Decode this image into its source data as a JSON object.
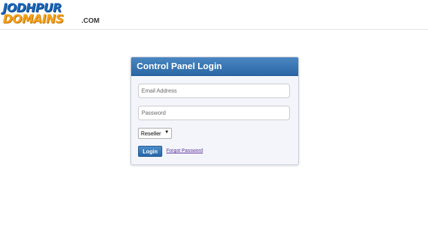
{
  "brand": {
    "line1": "JODHPUR",
    "line2": "DOMAINS",
    "suffix": ".COM",
    "colors": {
      "primary_blue": "#1a66b8",
      "accent_orange": "#f5a21b"
    }
  },
  "login": {
    "title": "Control Panel Login",
    "email_placeholder": "Email Address",
    "password_placeholder": "Password",
    "role_selected": "Reseller",
    "login_label": "Login",
    "forgot_label": "Forgot Password"
  },
  "theme": {
    "header_blue": "#2a67a4",
    "panel_background": "#f3f5fb",
    "link_color": "#5b2d99"
  }
}
